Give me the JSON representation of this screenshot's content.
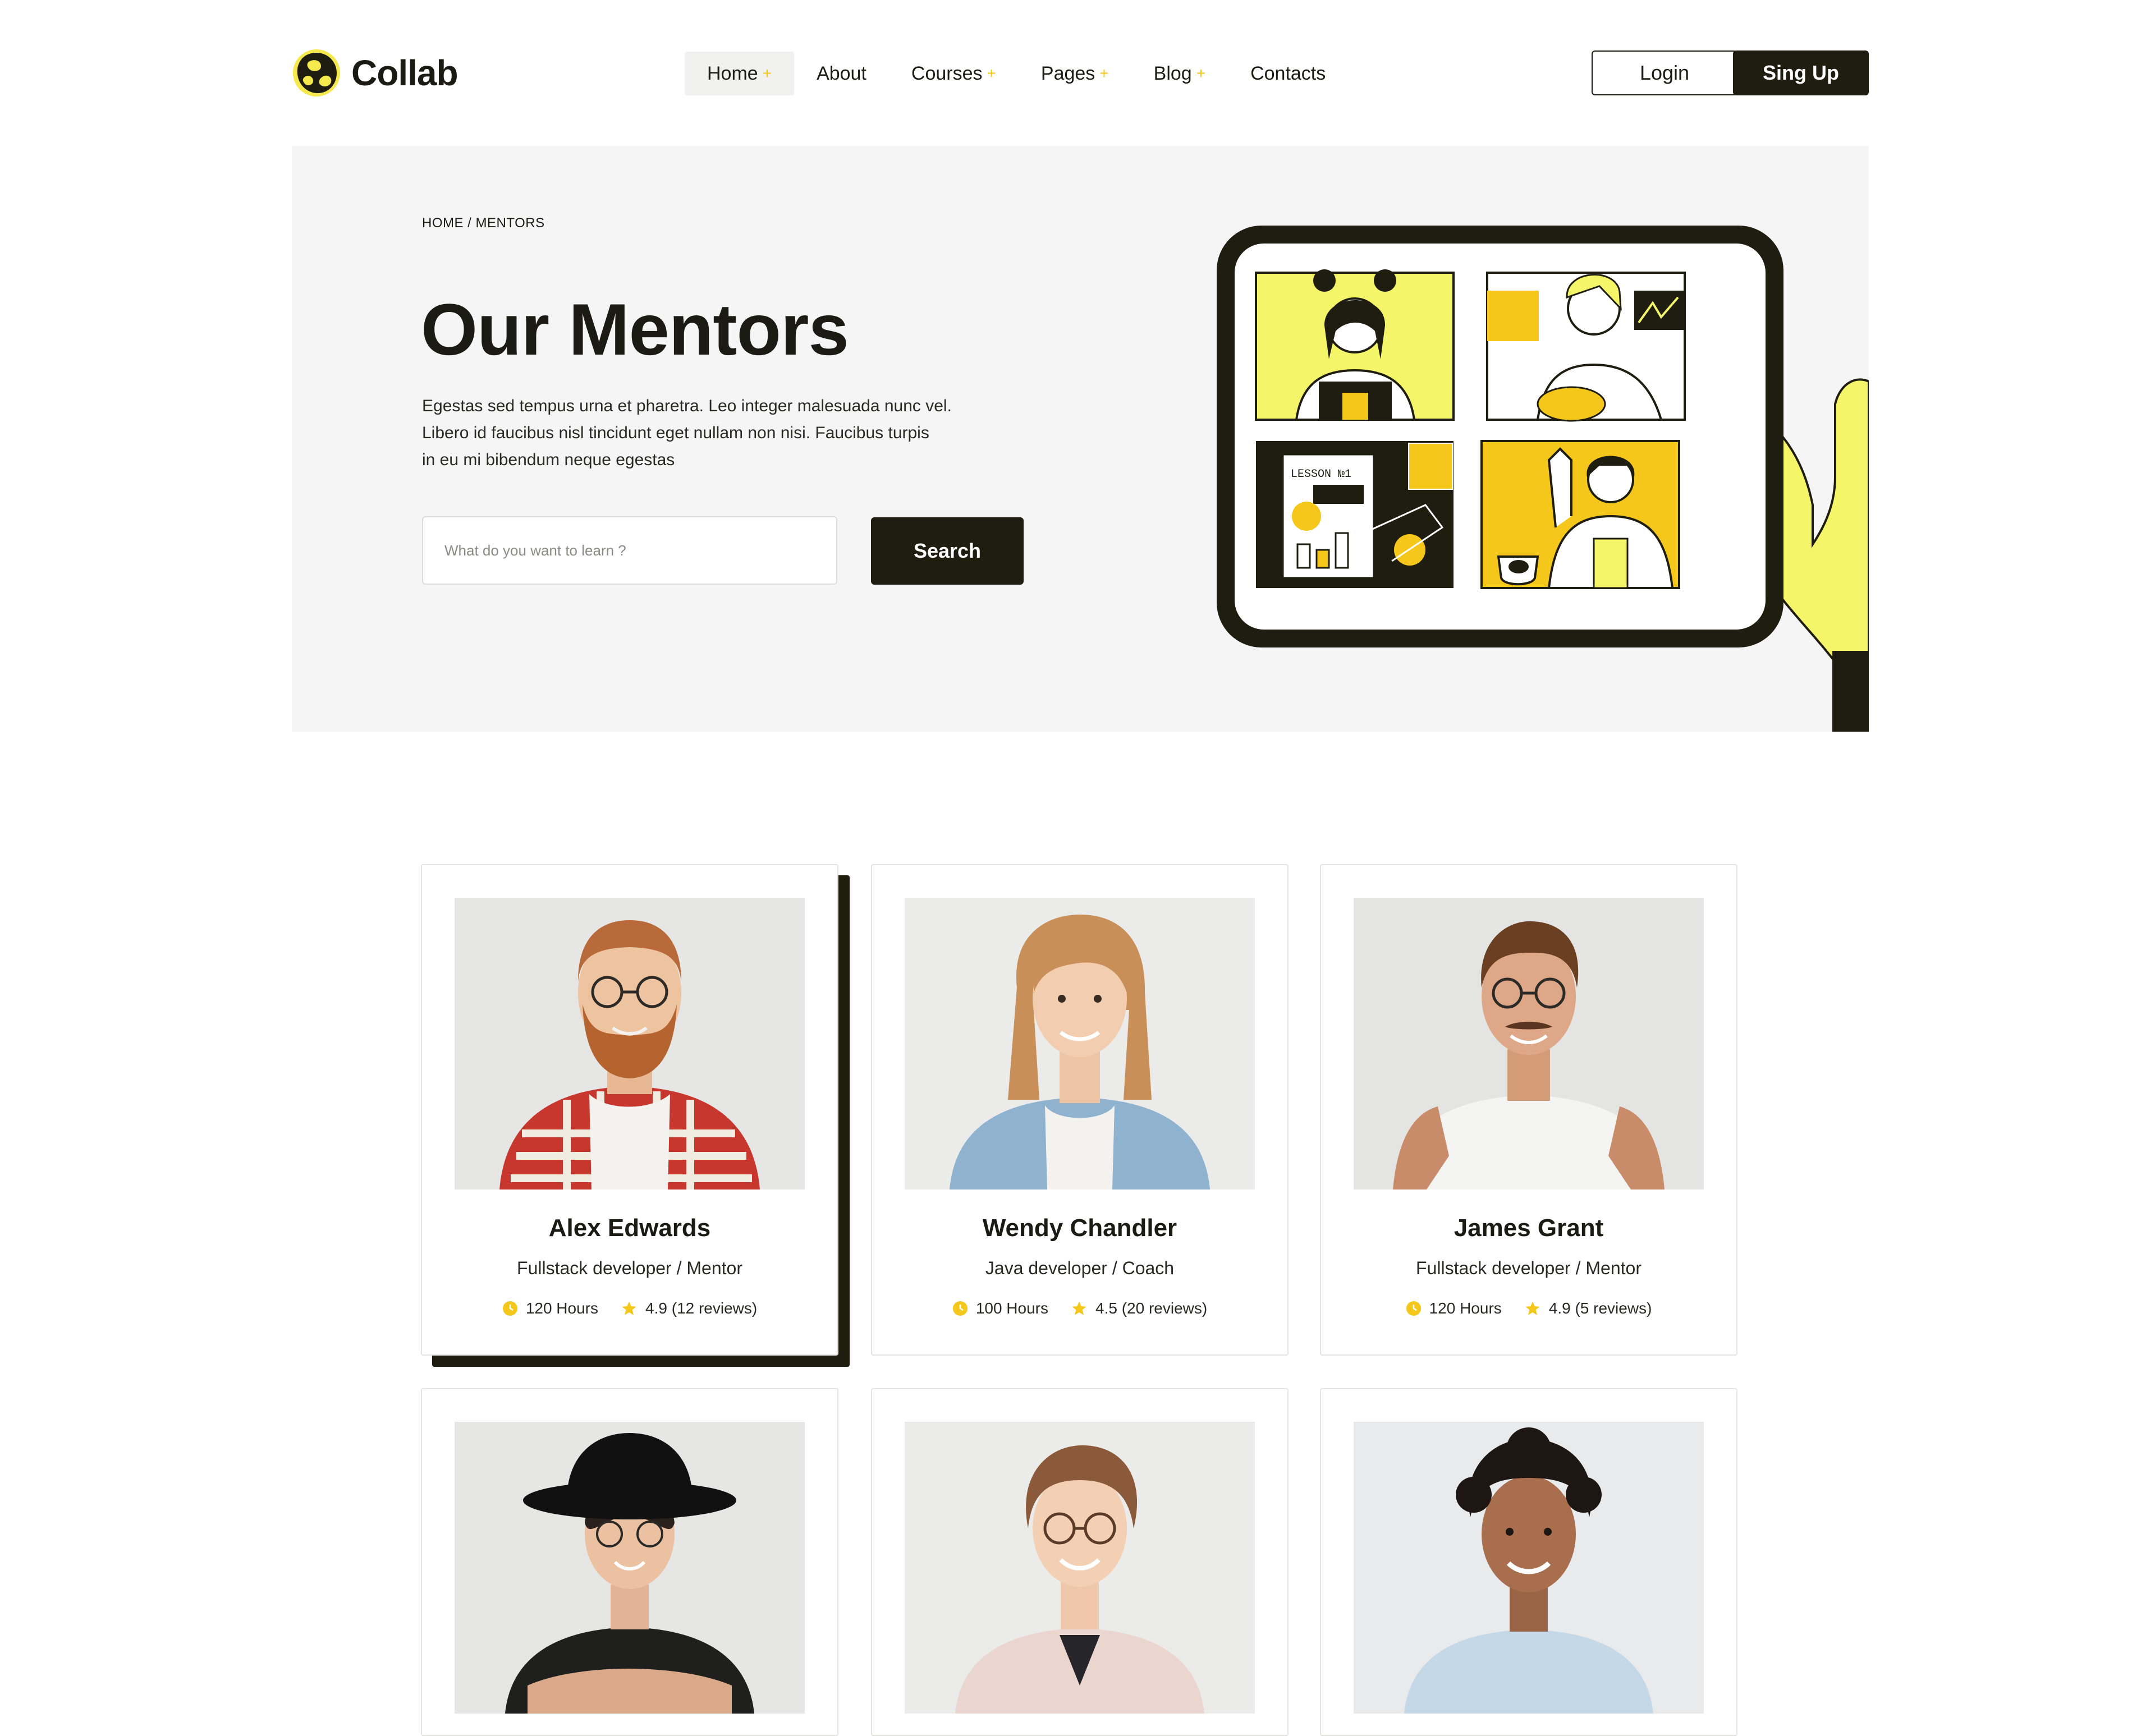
{
  "brand": {
    "name": "Collab",
    "accent": "#f5e94d",
    "dark": "#1e1d10",
    "gold": "#f5c71a"
  },
  "nav": {
    "items": [
      {
        "label": "Home",
        "has_submenu": true,
        "active": true
      },
      {
        "label": "About",
        "has_submenu": false
      },
      {
        "label": "Courses",
        "has_submenu": true
      },
      {
        "label": "Pages",
        "has_submenu": true
      },
      {
        "label": "Blog",
        "has_submenu": true
      },
      {
        "label": "Contacts",
        "has_submenu": false
      }
    ],
    "submenu_icon": "+"
  },
  "auth": {
    "login_label": "Login",
    "signup_label": "Sing Up"
  },
  "hero": {
    "breadcrumb": "HOME / MENTORS",
    "title": "Our Mentors",
    "lines": [
      "Egestas sed tempus urna et pharetra. Leo integer malesuada nunc vel.",
      "Libero id faucibus nisl tincidunt eget nullam non nisi. Faucibus turpis",
      "in eu mi bibendum neque egestas"
    ],
    "search_placeholder": "What do you want to learn ?",
    "search_label": "Search",
    "illustration_text": "LESSON №1"
  },
  "mentors": [
    {
      "name": "Alex Edwards",
      "role": "Fullstack developer / Mentor",
      "hours": "120 Hours",
      "rating": "4.9 (12 reviews)",
      "featured": true
    },
    {
      "name": "Wendy Chandler",
      "role": "Java developer / Coach",
      "hours": "100 Hours",
      "rating": "4.5 (20 reviews)"
    },
    {
      "name": "James Grant",
      "role": "Fullstack developer / Mentor",
      "hours": "120 Hours",
      "rating": "4.9 (5 reviews)"
    },
    {
      "name": "",
      "role": "",
      "hours": "",
      "rating": ""
    },
    {
      "name": "",
      "role": "",
      "hours": "",
      "rating": ""
    },
    {
      "name": "",
      "role": "",
      "hours": "",
      "rating": ""
    }
  ]
}
